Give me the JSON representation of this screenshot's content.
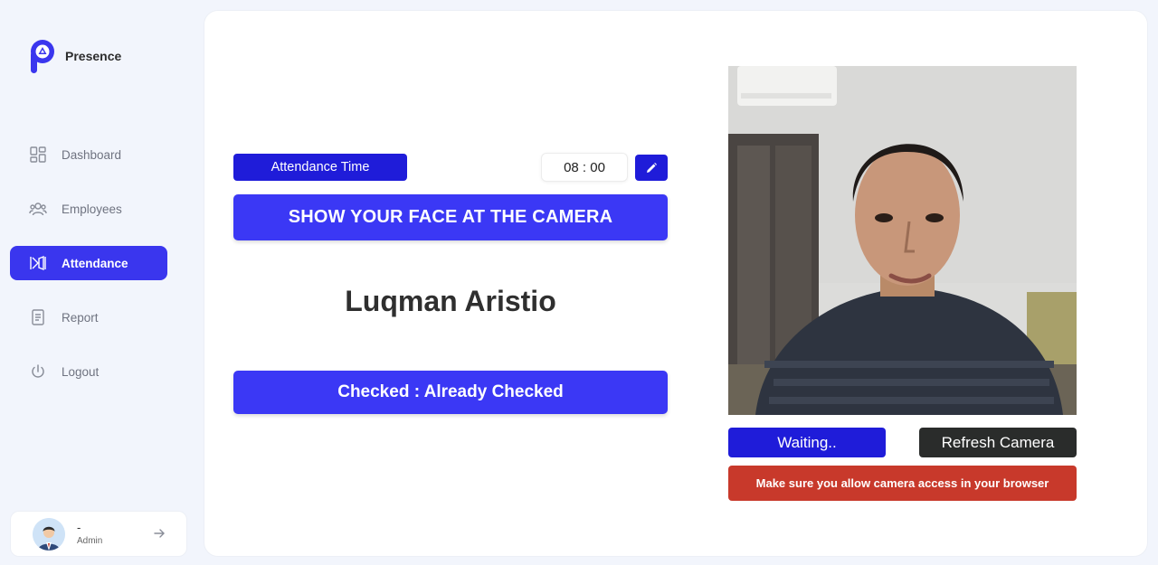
{
  "brand": {
    "name": "Presence",
    "color": "#3a36ee"
  },
  "nav": {
    "items": [
      {
        "label": "Dashboard",
        "icon": "dashboard-icon",
        "active": false
      },
      {
        "label": "Employees",
        "icon": "users-icon",
        "active": false
      },
      {
        "label": "Attendance",
        "icon": "attendance-icon",
        "active": true
      },
      {
        "label": "Report",
        "icon": "report-icon",
        "active": false
      },
      {
        "label": "Logout",
        "icon": "power-icon",
        "active": false
      }
    ]
  },
  "profile": {
    "name": "-",
    "role": "Admin"
  },
  "attendance": {
    "time_label": "Attendance Time",
    "time_value": "08 : 00",
    "instruction": "SHOW YOUR FACE AT THE CAMERA",
    "person_name": "Luqman Aristio",
    "status": "Checked : Already Checked"
  },
  "camera": {
    "waiting_label": "Waiting..",
    "refresh_label": "Refresh Camera",
    "alert": "Make sure you allow camera access in your browser"
  },
  "colors": {
    "accent": "#3b38f5",
    "accent_dark": "#1f1cd9",
    "alert": "#c8392b",
    "dark_button": "#2a2c2b"
  }
}
